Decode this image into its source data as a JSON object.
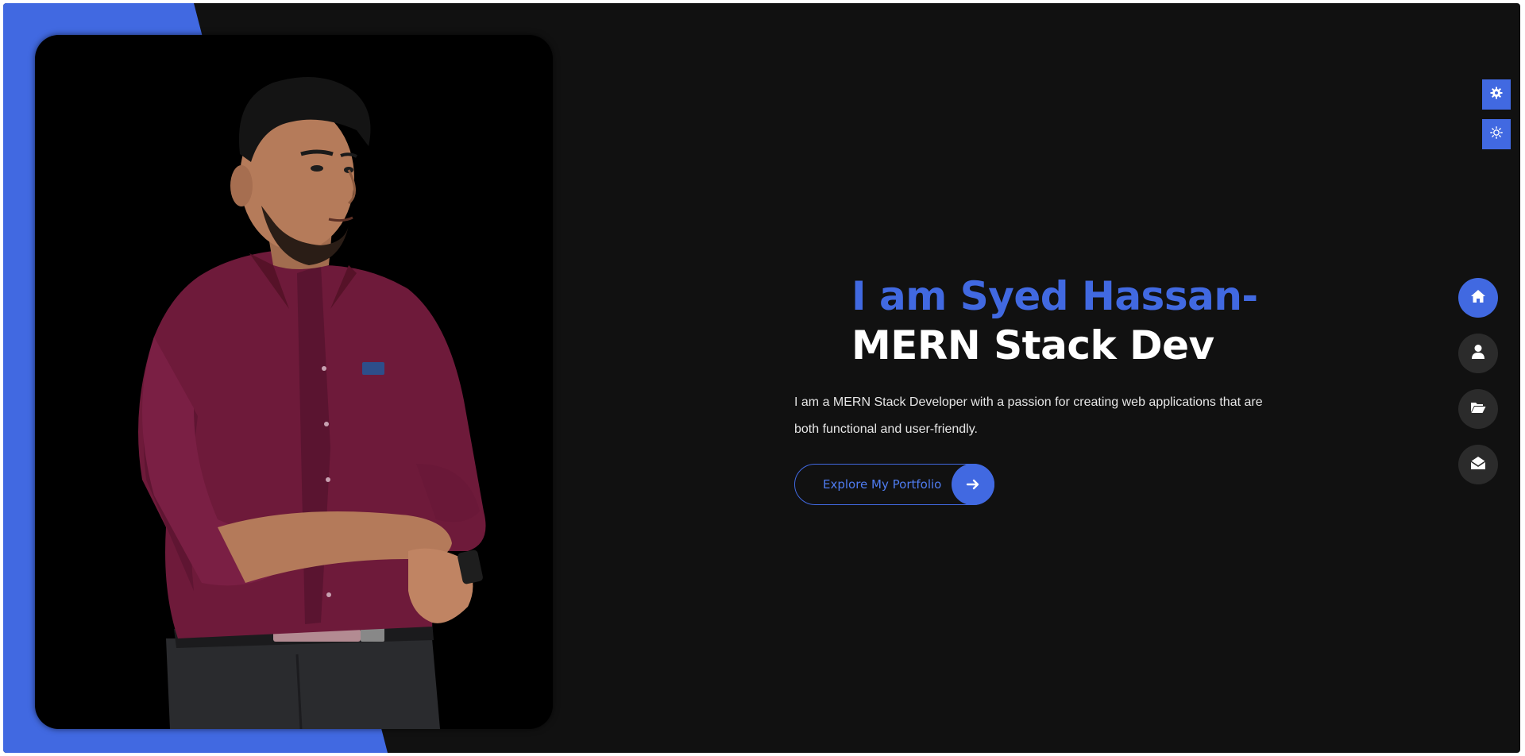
{
  "hero": {
    "headline_line1": "I am Syed Hassan-",
    "headline_line2": "MERN Stack Dev",
    "description": "I am a MERN Stack Developer with a passion for creating web applications that are both functional and user-friendly.",
    "cta_label": "Explore My Portfolio"
  },
  "profile_photo": {
    "alt": "Portrait of Syed Hassan in a maroon shirt"
  },
  "side_tools": [
    {
      "icon": "gear-icon"
    },
    {
      "icon": "sun-icon"
    }
  ],
  "side_nav": [
    {
      "icon": "home-icon",
      "active": true
    },
    {
      "icon": "user-icon",
      "active": false
    },
    {
      "icon": "folder-open-icon",
      "active": false
    },
    {
      "icon": "envelope-open-icon",
      "active": false
    }
  ],
  "colors": {
    "accent": "#4169e1",
    "background": "#111111",
    "nav_button": "#2b2b2b",
    "text_primary": "#ffffff"
  }
}
